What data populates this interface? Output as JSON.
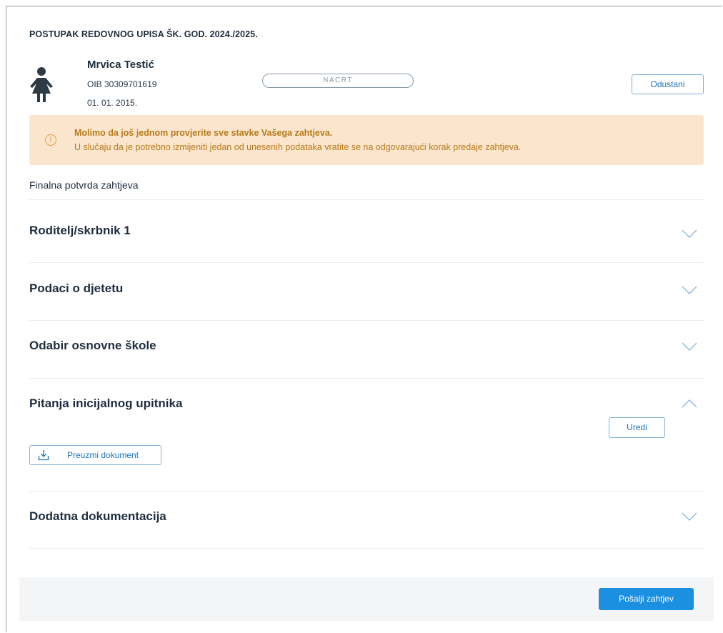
{
  "header": {
    "title": "POSTUPAK REDOVNOG UPISA ŠK. GOD. 2024./2025.",
    "status_badge": "NACRT",
    "cancel_label": "Odustani"
  },
  "child": {
    "name": "Mrvica Testić",
    "oib": "OIB 30309701619",
    "dob": "01. 01. 2015."
  },
  "alert": {
    "title": "Molimo da još jednom provjerite sve stavke Vašega zahtjeva.",
    "text": "U slučaju da je potrebno izmijeniti jedan od unesenih podataka vratite se na odgovarajući korak predaje zahtjeva.",
    "icon": "info-icon"
  },
  "main": {
    "section_title": "Finalna potvrda zahtjeva",
    "accordion": [
      {
        "title": "Roditelj/skrbnik 1",
        "expanded": false
      },
      {
        "title": "Podaci o djetetu",
        "expanded": false
      },
      {
        "title": "Odabir osnovne škole",
        "expanded": false
      },
      {
        "title": "Pitanja inicijalnog upitnika",
        "expanded": true,
        "edit_label": "Uredi",
        "download_label": "Preuzmi dokument"
      },
      {
        "title": "Dodatna dokumentacija",
        "expanded": false
      }
    ]
  },
  "footer": {
    "submit_label": "Pošalji zahtjev"
  },
  "colors": {
    "accent": "#1b8fe0",
    "link": "#1b75bb",
    "alert_bg": "#fbe6cd",
    "alert_text": "#b8791a",
    "footer_bg": "#f4f5f7"
  }
}
